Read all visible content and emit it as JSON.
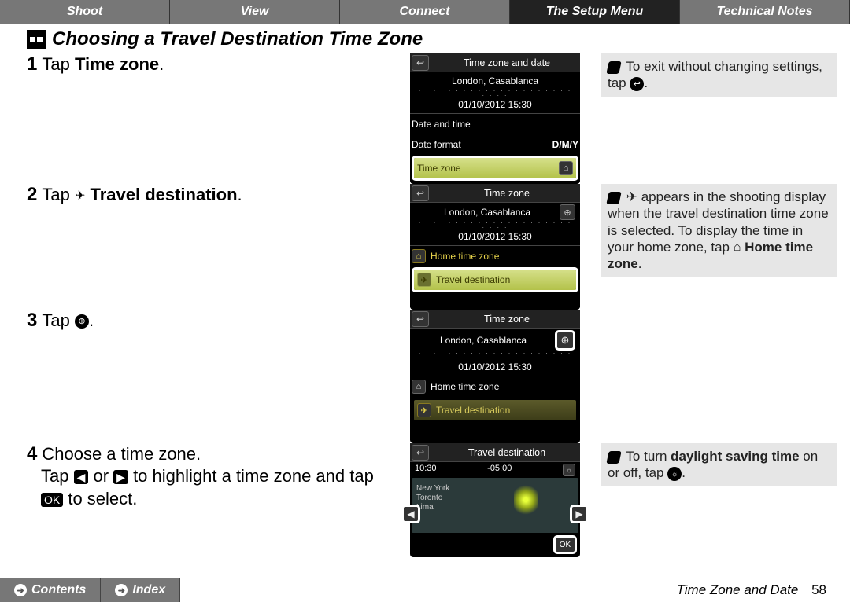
{
  "topnav": {
    "tabs": [
      "Shoot",
      "View",
      "Connect",
      "The Setup Menu",
      "Technical Notes"
    ],
    "active_index": 3
  },
  "heading": "Choosing a Travel Destination Time Zone",
  "steps": {
    "s1": {
      "num": "1",
      "prefix": "Tap ",
      "bold": "Time zone",
      "suffix": "."
    },
    "s2": {
      "num": "2",
      "prefix": "Tap ",
      "bold": "Travel destination",
      "suffix": "."
    },
    "s3": {
      "num": "3",
      "prefix": "Tap ",
      "suffix": "."
    },
    "s4": {
      "num": "4",
      "title_bold": "Choose a time zone.",
      "sub_a": "Tap ",
      "sub_b": " or ",
      "sub_c": " to highlight a time zone and tap ",
      "sub_ok": "OK",
      "sub_d": " to select."
    }
  },
  "notes": {
    "n1": {
      "text_a": "To exit without changing settings, tap ",
      "text_b": "."
    },
    "n2": {
      "text_a": " appears in the shooting display when the travel destination time zone is selected. To display the time in your home zone, tap ",
      "bold": "Home time zone",
      "text_b": "."
    },
    "n3": {
      "text_a": "To turn ",
      "bold": "daylight saving time",
      "text_b": " on or off, tap ",
      "text_c": "."
    }
  },
  "screens": {
    "sc1": {
      "title": "Time zone and date",
      "location": "London, Casablanca",
      "datetime": "01/10/2012  15:30",
      "row_date": "Date and time",
      "row_format_label": "Date format",
      "row_format_value": "D/M/Y",
      "hl": "Time zone"
    },
    "sc2": {
      "title": "Time zone",
      "location": "London, Casablanca",
      "datetime": "01/10/2012  15:30",
      "row_home": "Home time zone",
      "hl": "Travel destination"
    },
    "sc3": {
      "title": "Time zone",
      "location": "London, Casablanca",
      "datetime": "01/10/2012  15:30",
      "row_home": "Home time zone",
      "hl": "Travel destination"
    },
    "sc4": {
      "title": "Travel destination",
      "time_left": "10:30",
      "time_right": "-05:00",
      "city1": "New York",
      "city2": "Toronto",
      "city3": "Lima",
      "ok": "OK"
    }
  },
  "footer": {
    "contents": "Contents",
    "index": "Index",
    "right_label": "Time Zone and Date",
    "page": "58"
  }
}
